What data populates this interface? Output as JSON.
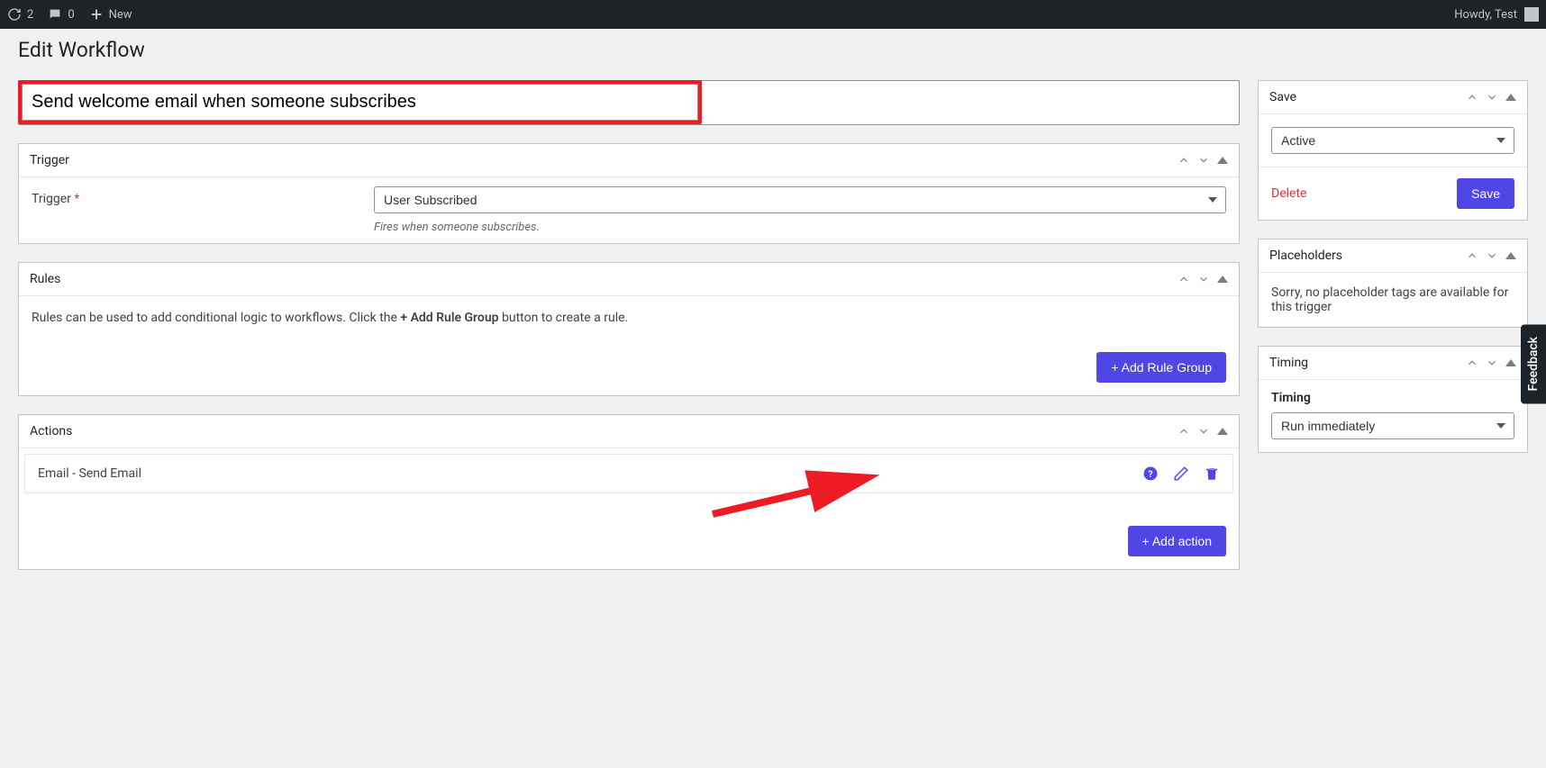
{
  "adminBar": {
    "refreshCount": "2",
    "commentCount": "0",
    "newLabel": "New",
    "greeting": "Howdy, Test"
  },
  "page": {
    "title": "Edit Workflow",
    "workflowTitle": "Send welcome email when someone subscribes"
  },
  "trigger": {
    "panelTitle": "Trigger",
    "fieldLabel": "Trigger",
    "selectedValue": "User Subscribed",
    "helperText": "Fires when someone subscribes."
  },
  "rules": {
    "panelTitle": "Rules",
    "descriptionPrefix": "Rules can be used to add conditional logic to workflows. Click the ",
    "descriptionBold": "+ Add Rule Group",
    "descriptionSuffix": " button to create a rule.",
    "addButtonLabel": "+ Add Rule Group"
  },
  "actions": {
    "panelTitle": "Actions",
    "items": [
      {
        "label": "Email - Send Email"
      }
    ],
    "addButtonLabel": "+ Add action"
  },
  "save": {
    "panelTitle": "Save",
    "statusValue": "Active",
    "deleteLabel": "Delete",
    "saveButtonLabel": "Save"
  },
  "placeholders": {
    "panelTitle": "Placeholders",
    "emptyText": "Sorry, no placeholder tags are available for this trigger"
  },
  "timing": {
    "panelTitle": "Timing",
    "fieldLabel": "Timing",
    "selectedValue": "Run immediately"
  },
  "feedback": {
    "label": "Feedback"
  }
}
